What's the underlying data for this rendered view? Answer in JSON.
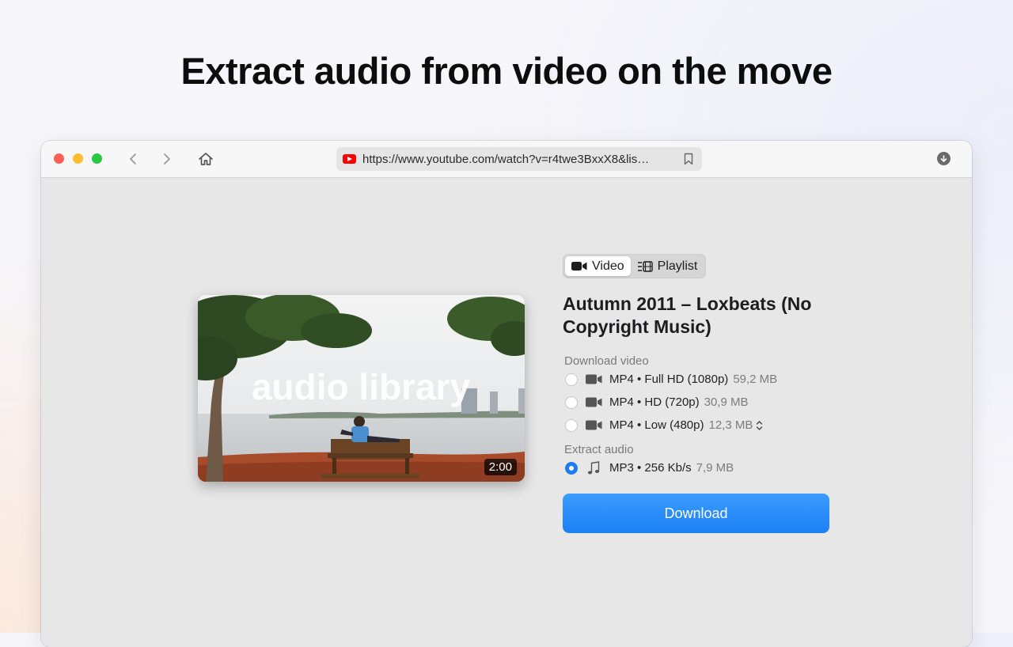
{
  "headline": "Extract audio from video on the move",
  "browser": {
    "url": "https://www.youtube.com/watch?v=r4twe3BxxX8&lis…"
  },
  "video": {
    "thumbnail_text": "audio library",
    "duration": "2:00",
    "title": "Autumn 2011 – Loxbeats (No Copyright Music)"
  },
  "tabs": [
    {
      "label": "Video",
      "active": true
    },
    {
      "label": "Playlist",
      "active": false
    }
  ],
  "download_video": {
    "label": "Download video",
    "options": [
      {
        "label": "MP4 • Full HD (1080p)",
        "size": "59,2 MB",
        "selected": false
      },
      {
        "label": "MP4 • HD (720p)",
        "size": "30,9 MB",
        "selected": false
      },
      {
        "label": "MP4 • Low (480p)",
        "size": "12,3 MB",
        "selected": false
      }
    ]
  },
  "extract_audio": {
    "label": "Extract audio",
    "option": {
      "label": "MP3 • 256 Kb/s",
      "size": "7,9 MB",
      "selected": true
    }
  },
  "download_button": "Download",
  "colors": {
    "accent": "#1b7cf5",
    "close": "#ff5f57",
    "minimize": "#febc2e",
    "zoom": "#28c840",
    "youtube": "#ff0000"
  }
}
